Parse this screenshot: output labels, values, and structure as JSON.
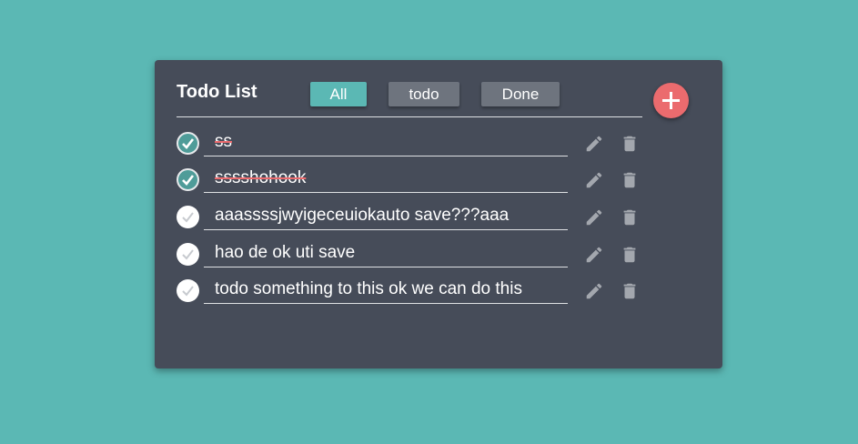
{
  "app": {
    "title": "Todo List",
    "filters": [
      {
        "label": "All",
        "active": true
      },
      {
        "label": "todo",
        "active": false
      },
      {
        "label": "Done",
        "active": false
      }
    ],
    "add_icon": "plus-icon"
  },
  "todos": [
    {
      "text": "ss",
      "done": true
    },
    {
      "text": "sssshohook",
      "done": true
    },
    {
      "text": "aaassssjwyigeceuiokauto save???aaa",
      "done": false
    },
    {
      "text": "hao de ok uti save",
      "done": false
    },
    {
      "text": "todo something to this ok we can do this",
      "done": false
    }
  ],
  "colors": {
    "background": "#5bb8b4",
    "card": "#464c59",
    "accent": "#5bb8b4",
    "add_button": "#eb6b6e",
    "strike": "#eb6b6e",
    "icon": "#a3a7ae"
  }
}
